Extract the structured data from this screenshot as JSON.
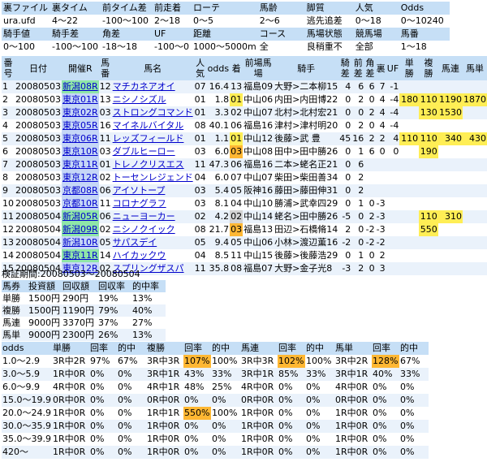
{
  "filter": {
    "header_row1": [
      "裏ファイル",
      "裏タイム",
      "前タイム差",
      "前走着",
      "ローテ",
      "馬齢",
      "脚質",
      "人気",
      "Odds"
    ],
    "value_row1": [
      "ura.ufd",
      "4〜22",
      "-100〜100",
      "2〜18",
      "0〜5",
      "2〜6",
      "逃先追差",
      "0〜18",
      "0〜10240"
    ],
    "header_row2": [
      "騎手値",
      "騎手差",
      "角差",
      "UF",
      "距離",
      "コース",
      "馬場状態",
      "競馬場",
      "馬番"
    ],
    "value_row2": [
      "0〜100",
      "-100〜100",
      "-18〜18",
      "-100〜0",
      "1000〜5000m",
      "全",
      "良稍重不",
      "全部",
      "1〜18"
    ]
  },
  "main_header": [
    "番号",
    "日付",
    "開催R",
    "馬番",
    "馬名",
    "人気",
    "odds",
    "着",
    "前場馬場",
    "騎手",
    "騎差",
    "前差",
    "角差",
    "裏",
    "UF",
    "単勝",
    "複勝",
    "馬連",
    "馬単"
  ],
  "rows": [
    {
      "no": "1",
      "date": "20080503",
      "venue": "新潟08R",
      "vc": "green",
      "ban": "12",
      "horse": "マチカネアオイ",
      "pop": "07",
      "odds": "16.4",
      "chaku": "13",
      "chaku_c": "",
      "mae": "福島09",
      "jockey": "大野>二本柳15",
      "kisa": "4",
      "maesa": "6",
      "kakusa": "6",
      "ura": "7",
      "uf": "-1",
      "tan": "",
      "fuku": "",
      "ren": "",
      "umatan": ""
    },
    {
      "no": "2",
      "date": "20080503",
      "venue": "東京01R",
      "vc": "blue",
      "ban": "13",
      "horse": "ニシノシズル",
      "pop": "01",
      "odds": "1.8",
      "chaku": "01",
      "chaku_c": "y",
      "mae": "中山06",
      "jockey": "内田>内田博22",
      "kisa": "0",
      "maesa": "2",
      "kakusa": "0",
      "ura": "4",
      "uf": "-4",
      "tan": "180",
      "fuku": "110",
      "ren": "1190",
      "umatan": "1870"
    },
    {
      "no": "3",
      "date": "20080503",
      "venue": "東京02R",
      "vc": "blue",
      "ban": "03",
      "horse": "ストロングコマンド",
      "pop": "01",
      "odds": "3.3",
      "chaku": "02",
      "chaku_c": "",
      "mae": "中山07",
      "jockey": "北村>北村宏21",
      "kisa": "0",
      "maesa": "0",
      "kakusa": "2",
      "ura": "4",
      "uf": "-4",
      "tan": "",
      "fuku": "130",
      "ren": "1530",
      "umatan": ""
    },
    {
      "no": "4",
      "date": "20080503",
      "venue": "東京05R",
      "vc": "blue",
      "ban": "16",
      "horse": "マイネルバイタル",
      "pop": "08",
      "odds": "40.1",
      "chaku": "06",
      "chaku_c": "",
      "mae": "福島16",
      "jockey": "津村>津村明20",
      "kisa": "0",
      "maesa": "2",
      "kakusa": "0",
      "ura": "4",
      "uf": "-4",
      "tan": "",
      "fuku": "",
      "ren": "",
      "umatan": ""
    },
    {
      "no": "5",
      "date": "20080503",
      "venue": "東京06R",
      "vc": "blue",
      "ban": "11",
      "horse": "レッズフィールド",
      "pop": "01",
      "odds": "1.1",
      "chaku": "01",
      "chaku_c": "y",
      "mae": "中山12",
      "jockey": "後藤>武 豊",
      "kisa": "45",
      "maesa": "16",
      "kakusa": "2",
      "ura": "2",
      "uf": "4",
      "tan": "110",
      "fuku": "110",
      "ren": "340",
      "umatan": "430"
    },
    {
      "no": "6",
      "date": "20080503",
      "venue": "東京10R",
      "vc": "blue",
      "ban": "03",
      "horse": "ダブルヒーロー",
      "pop": "03",
      "odds": "6.0",
      "chaku": "03",
      "chaku_c": "o",
      "mae": "中山08",
      "jockey": "田中>田中勝26",
      "kisa": "0",
      "maesa": "1",
      "kakusa": "6",
      "ura": "0",
      "uf": "0",
      "tan": "",
      "fuku": "190",
      "ren": "",
      "umatan": ""
    },
    {
      "no": "7",
      "date": "20080503",
      "venue": "東京11R",
      "vc": "blue",
      "ban": "01",
      "horse": "トレノクリスエス",
      "pop": "11",
      "odds": "47.3",
      "chaku": "06",
      "chaku_c": "",
      "mae": "福島16",
      "jockey": "二本>蛯名正21",
      "kisa": "0",
      "maesa": "6",
      "kakusa": "",
      "ura": "",
      "uf": "",
      "tan": "",
      "fuku": "",
      "ren": "",
      "umatan": ""
    },
    {
      "no": "8",
      "date": "20080503",
      "venue": "東京12R",
      "vc": "blue",
      "ban": "02",
      "horse": "トーセンレジェンド",
      "pop": "04",
      "odds": "6.0",
      "chaku": "07",
      "chaku_c": "",
      "mae": "中山07",
      "jockey": "柴田>柴田善34",
      "kisa": "0",
      "maesa": "2",
      "kakusa": "",
      "ura": "",
      "uf": "",
      "tan": "",
      "fuku": "",
      "ren": "",
      "umatan": ""
    },
    {
      "no": "9",
      "date": "20080503",
      "venue": "京都08R",
      "vc": "blue",
      "ban": "06",
      "horse": "アイソトープ",
      "pop": "03",
      "odds": "5.4",
      "chaku": "05",
      "chaku_c": "",
      "mae": "阪神16",
      "jockey": "藤田>藤田伸31",
      "kisa": "0",
      "maesa": "2",
      "kakusa": "",
      "ura": "",
      "uf": "",
      "tan": "",
      "fuku": "",
      "ren": "",
      "umatan": ""
    },
    {
      "no": "10",
      "date": "20080503",
      "venue": "京都10R",
      "vc": "blue",
      "ban": "11",
      "horse": "コロナグラフ",
      "pop": "03",
      "odds": "8.1",
      "chaku": "04",
      "chaku_c": "",
      "mae": "中山10",
      "jockey": "勝浦>武幸四29",
      "kisa": "0",
      "maesa": "1",
      "kakusa": "0",
      "ura": "-3",
      "uf": "",
      "tan": "",
      "fuku": "",
      "ren": "",
      "umatan": ""
    },
    {
      "no": "11",
      "date": "20080504",
      "venue": "新潟05R",
      "vc": "green",
      "ban": "06",
      "horse": "ニューヨーカー",
      "pop": "02",
      "odds": "4.2",
      "chaku": "02",
      "chaku_c": "gray",
      "mae": "中山14",
      "jockey": "蛯名>田中勝26",
      "kisa": "-5",
      "maesa": "0",
      "kakusa": "2",
      "ura": "-3",
      "uf": "",
      "tan": "",
      "fuku": "110",
      "ren": "310",
      "umatan": ""
    },
    {
      "no": "12",
      "date": "20080504",
      "venue": "新潟09R",
      "vc": "green",
      "ban": "02",
      "horse": "ニシノクイック",
      "pop": "08",
      "odds": "21.7",
      "chaku": "03",
      "chaku_c": "o",
      "mae": "福島13",
      "jockey": "田辺>石橋脩14",
      "kisa": "2",
      "maesa": "0",
      "kakusa": "-2",
      "ura": "-3",
      "uf": "",
      "tan": "",
      "fuku": "550",
      "ren": "",
      "umatan": ""
    },
    {
      "no": "13",
      "date": "20080504",
      "venue": "新潟10R",
      "vc": "blue",
      "ban": "05",
      "horse": "サパスデイ",
      "pop": "05",
      "odds": "9.4",
      "chaku": "05",
      "chaku_c": "",
      "mae": "中山06",
      "jockey": "小林>渡辺薫16",
      "kisa": "-2",
      "maesa": "0",
      "kakusa": "-2",
      "ura": "-2",
      "uf": "",
      "tan": "",
      "fuku": "",
      "ren": "",
      "umatan": ""
    },
    {
      "no": "14",
      "date": "20080504",
      "venue": "東京11R",
      "vc": "green",
      "ban": "14",
      "horse": "ハイカックウ",
      "pop": "04",
      "odds": "8.5",
      "chaku": "11",
      "chaku_c": "",
      "mae": "中山15",
      "jockey": "後藤>後藤浩29",
      "kisa": "0",
      "maesa": "1",
      "kakusa": "0",
      "ura": "2",
      "uf": "",
      "tan": "",
      "fuku": "",
      "ren": "",
      "umatan": ""
    },
    {
      "no": "15",
      "date": "20080504",
      "venue": "東京12R",
      "vc": "blue",
      "ban": "02",
      "horse": "スプリングザスパ",
      "pop": "11",
      "odds": "35.8",
      "chaku": "08",
      "chaku_c": "",
      "mae": "福島07",
      "jockey": "大野>金子光8",
      "kisa": "-3",
      "maesa": "2",
      "kakusa": "0",
      "ura": "3",
      "uf": "",
      "tan": "",
      "fuku": "",
      "ren": "",
      "umatan": ""
    }
  ],
  "period": "検証期間:20080503〜20080504",
  "summary": {
    "header": [
      "馬券",
      "投資額",
      "回収額",
      "回収率",
      "的中率"
    ],
    "rows": [
      [
        "単勝",
        "1500円",
        "290円",
        "19%",
        "13%"
      ],
      [
        "複勝",
        "1500円",
        "1190円",
        "79%",
        "40%"
      ],
      [
        "馬連",
        "9000円",
        "3370円",
        "37%",
        "27%"
      ],
      [
        "馬単",
        "9000円",
        "2300円",
        "26%",
        "13%"
      ]
    ]
  },
  "odds_table": {
    "header": [
      "odds",
      "単勝",
      "回率",
      "的中",
      "複勝",
      "回率",
      "的中",
      "馬連",
      "回率",
      "的中",
      "馬単",
      "回率",
      "的中"
    ],
    "rows": [
      [
        "1.0〜2.9",
        "3R中2R",
        "97%",
        "67%",
        "3R中3R",
        "107%",
        "100%",
        "3R中3R",
        "102%",
        "100%",
        "3R中2R",
        "128%",
        "67%"
      ],
      [
        "3.0〜5.9",
        "1R中0R",
        "0%",
        "0%",
        "3R中1R",
        "43%",
        "33%",
        "3R中1R",
        "85%",
        "33%",
        "3R中1R",
        "40%",
        "33%"
      ],
      [
        "6.0〜9.9",
        "4R中0R",
        "0%",
        "0%",
        "4R中1R",
        "48%",
        "25%",
        "4R中0R",
        "0%",
        "0%",
        "4R中0R",
        "0%",
        "0%"
      ],
      [
        "15.0〜19.9",
        "0R中0R",
        "0%",
        "0%",
        "0R中0R",
        "0%",
        "0%",
        "0R中0R",
        "0%",
        "0%",
        "0R中0R",
        "0%",
        "0%"
      ],
      [
        "20.0〜24.9",
        "1R中0R",
        "0%",
        "0%",
        "1R中1R",
        "550%",
        "100%",
        "1R中0R",
        "0%",
        "0%",
        "1R中0R",
        "0%",
        "0%"
      ],
      [
        "30.0〜35.9",
        "1R中0R",
        "0%",
        "0%",
        "1R中0R",
        "0%",
        "0%",
        "1R中0R",
        "0%",
        "0%",
        "1R中0R",
        "0%",
        "0%"
      ],
      [
        "35.0〜39.9",
        "1R中0R",
        "0%",
        "0%",
        "1R中0R",
        "0%",
        "0%",
        "1R中0R",
        "0%",
        "0%",
        "1R中0R",
        "0%",
        "0%"
      ],
      [
        "420〜",
        "1R中0R",
        "0%",
        "0%",
        "1R中0R",
        "0%",
        "0%",
        "1R中0R",
        "0%",
        "0%",
        "1R中0R",
        "0%",
        "0%"
      ]
    ]
  },
  "colors": {
    "header": "#c6dff6",
    "yellow": "#ffee55",
    "orange": "#ffb733",
    "stripe": "#eaf2fb"
  }
}
